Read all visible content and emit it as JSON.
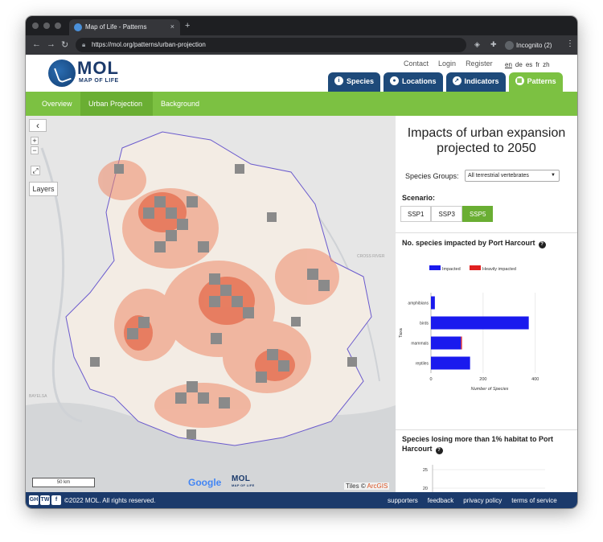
{
  "browser": {
    "tab_title": "Map of Life - Patterns",
    "tab_close": "×",
    "new_tab": "+",
    "url": "https://mol.org/patterns/urban-projection",
    "profile": "Incognito (2)"
  },
  "header": {
    "logo_title": "MOL",
    "logo_subtitle": "MAP OF LIFE",
    "links": [
      "Contact",
      "Login",
      "Register"
    ],
    "languages": [
      "en",
      "de",
      "es",
      "fr",
      "zh"
    ],
    "active_language": "en",
    "nav_tabs": [
      {
        "label": "Species",
        "icon": "info-icon"
      },
      {
        "label": "Locations",
        "icon": "location-pin-icon"
      },
      {
        "label": "Indicators",
        "icon": "trend-chart-icon"
      },
      {
        "label": "Patterns",
        "icon": "grid-icon"
      }
    ],
    "active_nav": "Patterns"
  },
  "subnav": {
    "items": [
      "Overview",
      "Urban Projection",
      "Background"
    ],
    "active": "Urban Projection"
  },
  "map": {
    "back_label": "‹",
    "zoom_in": "+",
    "zoom_out": "−",
    "fullscreen": "⤢",
    "layers_label": "Layers",
    "scale_label": "50 km",
    "google_label": "Google",
    "mol_label": "MOL",
    "mol_sub": "MAP OF LIFE",
    "attribution_prefix": "Tiles © ",
    "attribution_brand": "ArcGIS",
    "place_labels": [
      "CROSS RIVER",
      "BAYELSA"
    ]
  },
  "panel": {
    "title": "Impacts of urban expansion projected to 2050",
    "species_groups_label": "Species Groups:",
    "species_groups_value": "All terrestrial vertebrates",
    "scenario_label": "Scenario:",
    "scenarios": [
      "SSP1",
      "SSP3",
      "SSP5"
    ],
    "active_scenario": "SSP5",
    "chart1_title": "No. species impacted by Port Harcourt",
    "chart2_title": "Species losing more than 1% habitat to Port Harcourt"
  },
  "chart_data": [
    {
      "type": "bar",
      "orientation": "horizontal",
      "title": "No. species impacted by Port Harcourt",
      "categories": [
        "amphibians",
        "birds",
        "mammals",
        "reptiles"
      ],
      "series": [
        {
          "name": "Impacted",
          "color": "#1a1aee",
          "values": [
            15,
            375,
            115,
            150
          ]
        },
        {
          "name": "Heavily impacted",
          "color": "#e02020",
          "values": [
            0,
            0,
            4,
            0
          ]
        }
      ],
      "xlabel": "Number of Species",
      "ylabel": "Taxa",
      "xticks": [
        0,
        200,
        400
      ],
      "xlim": [
        0,
        450
      ],
      "grid": true,
      "legend": "top"
    },
    {
      "type": "line",
      "title": "Species losing more than 1% habitat to Port Harcourt",
      "yticks": [
        20,
        25
      ],
      "series": []
    }
  ],
  "footer": {
    "social": [
      "GH",
      "TW",
      "f"
    ],
    "copyright": "©2022 MOL. All rights reserved.",
    "links": [
      "supporters",
      "feedback",
      "privacy policy",
      "terms of service"
    ]
  }
}
